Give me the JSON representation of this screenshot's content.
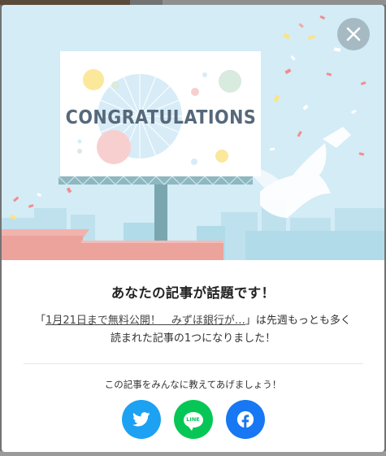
{
  "modal": {
    "banner_text": "CONGRATULATIONS",
    "title": "あなたの記事が話題です！",
    "message": {
      "open_quote": "「",
      "article_link": "1月21日まで無料公開！　みずほ銀行が…",
      "close_quote_and_text": "」は先週もっとも多く",
      "line2": "読まれた記事の1つになりました！"
    },
    "share_prompt": "この記事をみんなに教えてあげましょう！",
    "share_buttons": [
      {
        "service": "twitter",
        "icon": "twitter-bird-icon",
        "color": "#1da1f2"
      },
      {
        "service": "line",
        "icon": "line-icon",
        "label": "LINE",
        "color": "#06c755"
      },
      {
        "service": "facebook",
        "icon": "facebook-f-icon",
        "color": "#1877f2"
      }
    ],
    "close_icon": "close-icon"
  },
  "colors": {
    "hero_background": "#d3ecf6",
    "billboard_text": "#56687a",
    "pink_buildings": "#eba39c"
  }
}
